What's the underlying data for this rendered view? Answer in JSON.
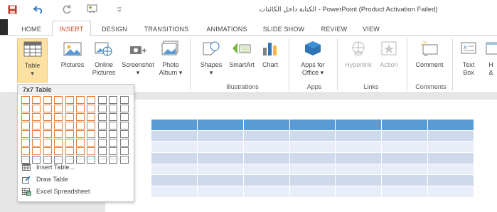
{
  "window": {
    "title": "الكتابة داخل الكائنات - PowerPoint (Product Activation Failed)"
  },
  "quick_access": [
    {
      "icon": "save-icon"
    },
    {
      "icon": "undo-icon"
    },
    {
      "icon": "redo-icon"
    },
    {
      "icon": "start-from-beginning-icon"
    },
    {
      "icon": "customize-qat-icon"
    }
  ],
  "tabs": [
    {
      "label": "HOME"
    },
    {
      "label": "INSERT"
    },
    {
      "label": "DESIGN"
    },
    {
      "label": "TRANSITIONS"
    },
    {
      "label": "ANIMATIONS"
    },
    {
      "label": "SLIDE SHOW"
    },
    {
      "label": "REVIEW"
    },
    {
      "label": "VIEW"
    }
  ],
  "ribbon": {
    "buttons": {
      "table": "Table",
      "pictures": "Pictures",
      "online_pictures_1": "Online",
      "online_pictures_2": "Pictures",
      "screenshot": "Screenshot",
      "photo_album_1": "Photo",
      "photo_album_2": "Album ▾",
      "shapes": "Shapes",
      "smartart": "SmartArt",
      "chart": "Chart",
      "apps_for_office_1": "Apps for",
      "apps_for_office_2": "Office ▾",
      "hyperlink": "Hyperlink",
      "action": "Action",
      "comment": "Comment",
      "text_box_1": "Text",
      "text_box_2": "Box",
      "header_footer_1": "H",
      "header_footer_2": "&"
    },
    "groups": {
      "illustrations": "Illustrations",
      "apps": "Apps",
      "links": "Links",
      "comments": "Comments"
    }
  },
  "table_dropdown": {
    "title": "7x7 Table",
    "grid_columns": 10,
    "grid_rows": 8,
    "selected_columns": 7,
    "selected_rows": 7,
    "items": [
      {
        "label": "Insert Table...",
        "icon": "insert-table-icon"
      },
      {
        "label": "Draw Table",
        "icon": "draw-table-icon"
      },
      {
        "label": "Excel Spreadsheet",
        "icon": "excel-spreadsheet-icon"
      }
    ]
  },
  "slide_table": {
    "rows": 7,
    "columns": 7
  },
  "colors": {
    "accent": "#d24726",
    "selection_orange": "#e87a33",
    "table_header": "#5b9bd5",
    "table_band_odd": "#cfd9ec",
    "table_band_even": "#e8edf7",
    "table_button_bg": "#fde1a2"
  }
}
